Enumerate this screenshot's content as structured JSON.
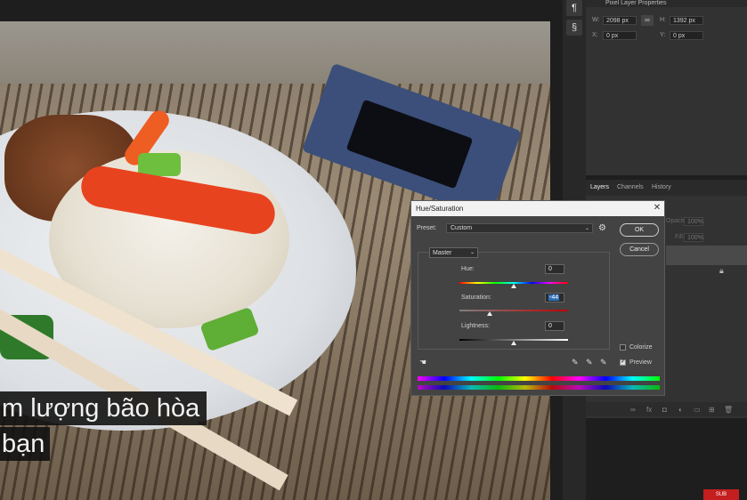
{
  "subtitle": {
    "line1": "m lượng bão hòa",
    "line2": "bạn"
  },
  "properties": {
    "title": "Pixel Layer Properties",
    "w_label": "W:",
    "w_value": "2098 px",
    "h_label": "H:",
    "h_value": "1392 px",
    "x_label": "X:",
    "x_value": "0 px",
    "y_label": "Y:",
    "y_value": "0 px"
  },
  "layers_panel": {
    "tabs": [
      "Layers",
      "Channels",
      "History"
    ],
    "opacity_label": "Opacity:",
    "opacity_value": "100%",
    "fill_label": "Fill:",
    "fill_value": "100%"
  },
  "dialog": {
    "title": "Hue/Saturation",
    "close_glyph": "✕",
    "preset_label": "Preset:",
    "preset_value": "Custom",
    "ok_label": "OK",
    "cancel_label": "Cancel",
    "channel": "Master",
    "hue_label": "Hue:",
    "hue_value": "0",
    "hue_level": 0.5,
    "saturation_label": "Saturation:",
    "saturation_value": "-44",
    "saturation_level": 0.28,
    "lightness_label": "Lightness:",
    "lightness_value": "0",
    "lightness_level": 0.5,
    "colorize_label": "Colorize",
    "colorize_checked": false,
    "preview_label": "Preview",
    "preview_checked": true
  },
  "badge": "SUB",
  "colors": {
    "accent_selection": "#2e6fb9",
    "badge_red": "#c41e1e"
  },
  "icons": [
    "hand-target-icon",
    "eyedropper-icon",
    "eyedropper-plus-icon",
    "eyedropper-minus-icon",
    "gear-icon",
    "link-icon",
    "lock-icon"
  ]
}
